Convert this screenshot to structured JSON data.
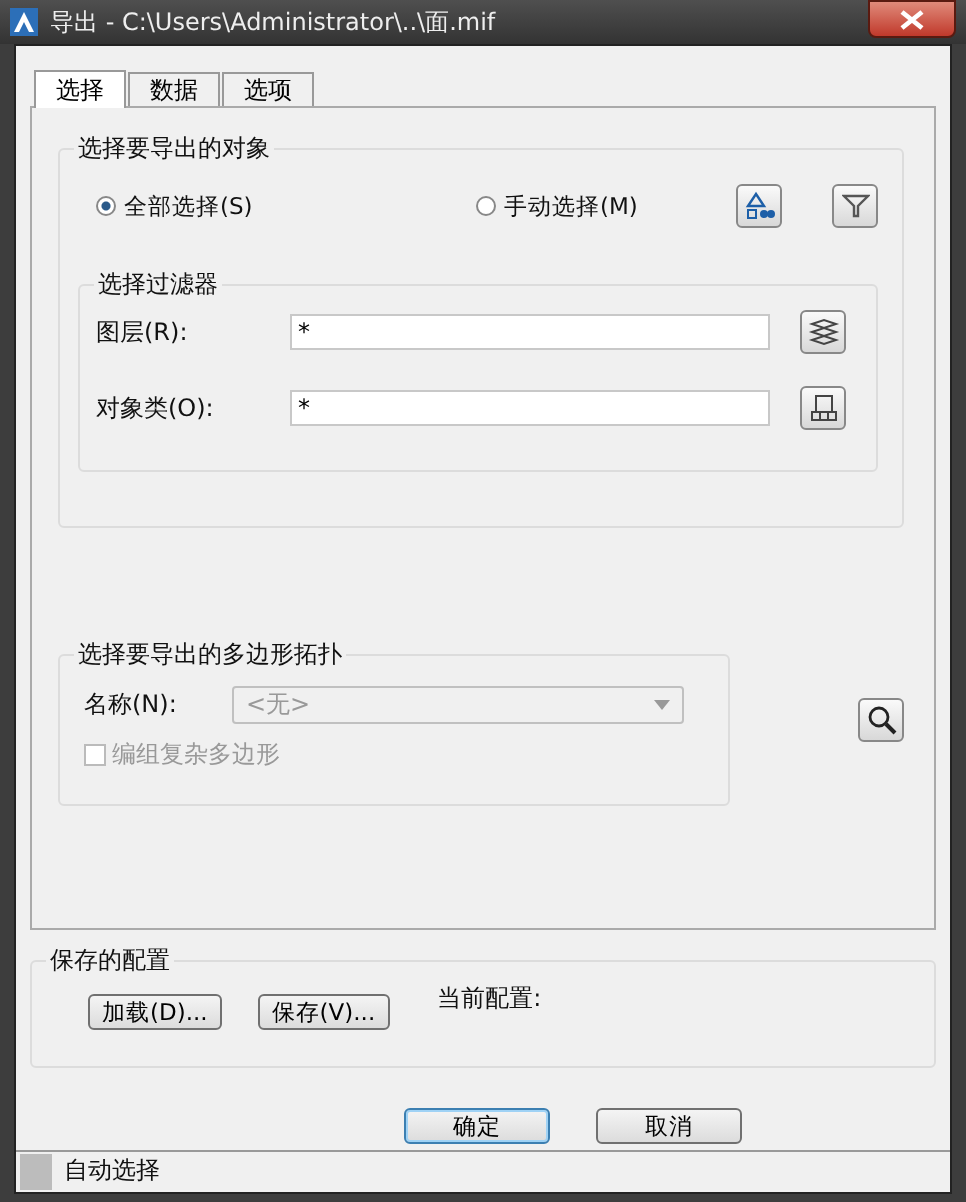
{
  "window": {
    "title": "导出 - C:\\Users\\Administrator\\..\\面.mif"
  },
  "tabs": [
    {
      "label": "选择",
      "selected": true
    },
    {
      "label": "数据",
      "selected": false
    },
    {
      "label": "选项",
      "selected": false
    }
  ],
  "objects_group": {
    "title": "选择要导出的对象",
    "options": [
      {
        "label": "全部选择(S)",
        "selected": true
      },
      {
        "label": "手动选择(M)",
        "selected": false
      }
    ]
  },
  "filter_group": {
    "title": "选择过滤器",
    "fields": [
      {
        "label": "图层(R):",
        "value": "*"
      },
      {
        "label": "对象类(O):",
        "value": "*"
      }
    ]
  },
  "topology_group": {
    "title": "选择要导出的多边形拓扑",
    "name_label": "名称(N):",
    "name_value": "<无>",
    "disabled": true,
    "checkbox": {
      "label": "编组复杂多边形",
      "checked": false,
      "disabled": true
    }
  },
  "saved_config": {
    "title": "保存的配置",
    "buttons": [
      "加载(D)...",
      "保存(V)..."
    ],
    "current_label": "当前配置:"
  },
  "buttons": [
    {
      "label": "确定",
      "default": true
    },
    {
      "label": "取消",
      "default": false
    }
  ],
  "status_bar": {
    "text": "自动选择"
  }
}
